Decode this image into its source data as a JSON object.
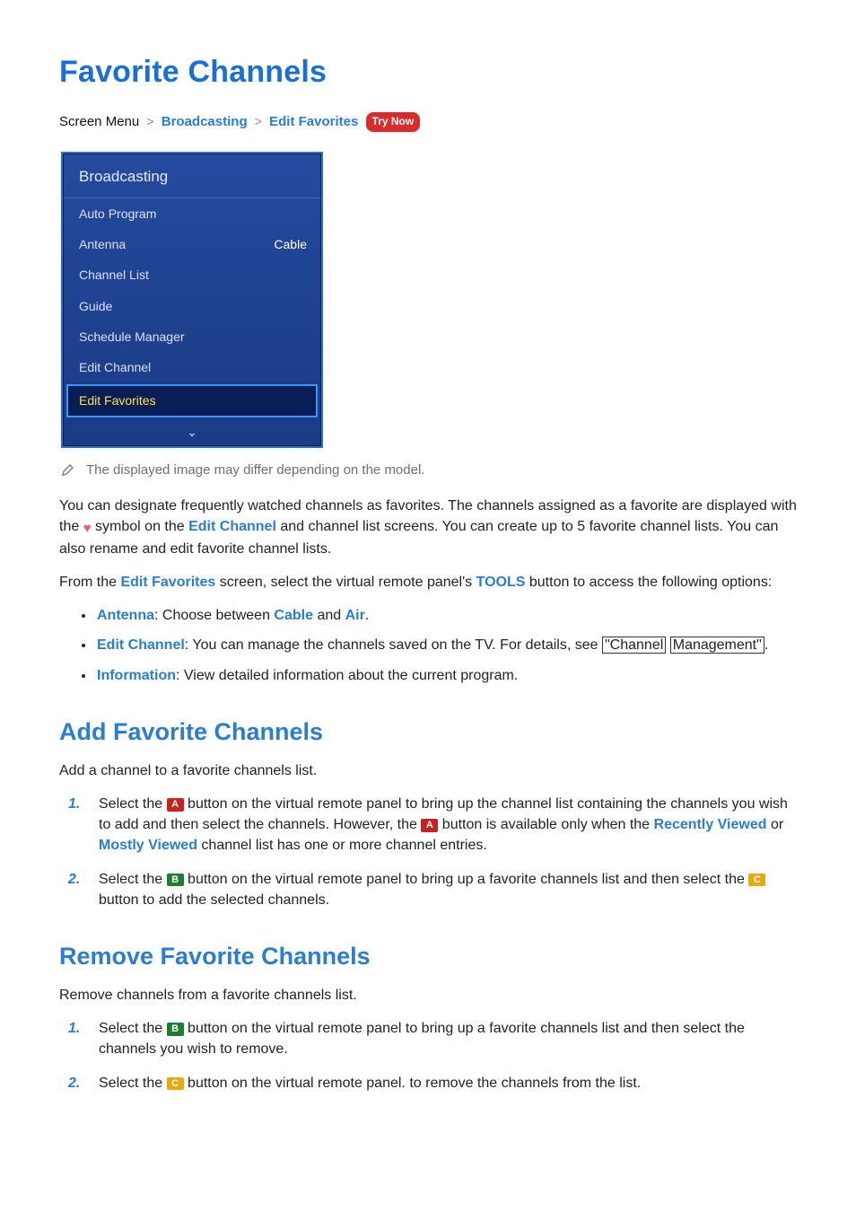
{
  "title": "Favorite Channels",
  "breadcrumb": {
    "root": "Screen Menu",
    "sep": ">",
    "seg1": "Broadcasting",
    "seg2": "Edit Favorites",
    "trynow": "Try Now"
  },
  "osd": {
    "header": "Broadcasting",
    "row_auto_program": "Auto Program",
    "row_antenna_label": "Antenna",
    "row_antenna_value": "Cable",
    "row_channel_list": "Channel List",
    "row_guide": "Guide",
    "row_schedule_mgr": "Schedule Manager",
    "row_edit_channel": "Edit Channel",
    "row_edit_favorites": "Edit Favorites",
    "arrow_glyph": "⌄"
  },
  "note_text": "The displayed image may differ depending on the model.",
  "para1": {
    "t1": "You can designate frequently watched channels as favorites. The channels assigned as a favorite are displayed with the ",
    "t2": " symbol on the ",
    "edit_channel": "Edit Channel",
    "t3": " and channel list screens. You can create up to 5 favorite channel lists. You can also rename and edit favorite channel lists."
  },
  "para2": {
    "t1": "From the ",
    "edit_fav": "Edit Favorites",
    "t2": " screen, select the virtual remote panel's ",
    "tools": "TOOLS",
    "t3": " button to access the following options:"
  },
  "bullets": {
    "b1": {
      "name": "Antenna",
      "text1": ": Choose between ",
      "cable": "Cable",
      "and": " and ",
      "air": "Air",
      "tail": "."
    },
    "b2": {
      "name": "Edit Channel",
      "text1": ": You can manage the channels saved on the TV. For details, see ",
      "link1": "\"Channel",
      "link2": "Management\"",
      "tail": "."
    },
    "b3": {
      "name": "Information",
      "text1": ": View detailed information about the current program."
    }
  },
  "sec_add": {
    "heading": "Add Favorite Channels",
    "intro": "Add a channel to a favorite channels list.",
    "step1": {
      "t1": "Select the ",
      "btnA": "A",
      "t2": " button on the virtual remote panel to bring up the channel list containing the channels you wish to add and then select the channels. However, the ",
      "btnA2": "A",
      "t3": " button is available only when the ",
      "rv": "Recently Viewed",
      "or": " or ",
      "mv": "Mostly Viewed",
      "t4": " channel list has one or more channel entries."
    },
    "step2": {
      "t1": "Select the ",
      "btnB": "B",
      "t2": " button on the virtual remote panel to bring up a favorite channels list and then select the ",
      "btnC": "C",
      "t3": " button to add the selected channels."
    }
  },
  "sec_remove": {
    "heading": "Remove Favorite Channels",
    "intro": "Remove channels from a favorite channels list.",
    "step1": {
      "t1": "Select the ",
      "btnB": "B",
      "t2": " button on the virtual remote panel to bring up a favorite channels list and then select the channels you wish to remove."
    },
    "step2": {
      "t1": "Select the ",
      "btnC": "C",
      "t2": " button on the virtual remote panel. to remove the channels from the list."
    }
  }
}
